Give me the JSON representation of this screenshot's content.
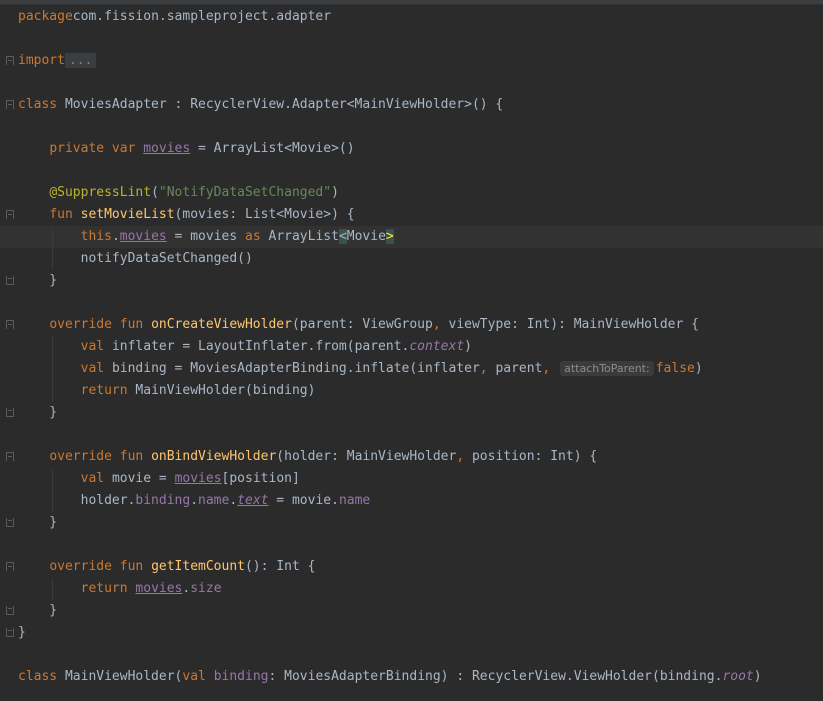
{
  "editor": {
    "lines": [
      {
        "parts": [
          [
            "kw",
            "package"
          ],
          [
            "",
            "com.fission.sampleproject.adapter"
          ]
        ]
      },
      {
        "parts": []
      },
      {
        "parts": [
          [
            "kw",
            "import"
          ],
          [
            "",
            ""
          ],
          [
            "fold-dots",
            "..."
          ]
        ]
      },
      {
        "parts": []
      },
      {
        "parts": [
          [
            "kw",
            "class"
          ],
          [
            "",
            " MoviesAdapter : RecyclerView.Adapter<MainViewHolder>() {"
          ]
        ]
      },
      {
        "parts": []
      },
      {
        "parts": [
          [
            "",
            "    "
          ],
          [
            "kw",
            "private var "
          ],
          [
            "prop ul",
            "movies"
          ],
          [
            "",
            " = ArrayList<Movie>()"
          ]
        ]
      },
      {
        "parts": []
      },
      {
        "parts": [
          [
            "",
            "    "
          ],
          [
            "ann",
            "@SuppressLint"
          ],
          [
            "",
            "("
          ],
          [
            "str",
            "\"NotifyDataSetChanged\""
          ],
          [
            "",
            ")"
          ]
        ]
      },
      {
        "parts": [
          [
            "",
            "    "
          ],
          [
            "kw",
            "fun "
          ],
          [
            "fn",
            "setMovieList"
          ],
          [
            "",
            "(movies: List<Movie>) {"
          ]
        ]
      },
      {
        "parts": [
          [
            "",
            "        "
          ],
          [
            "kw",
            "this"
          ],
          [
            "",
            "."
          ],
          [
            "prop ul",
            "movies"
          ],
          [
            "",
            " = movies "
          ],
          [
            "kw",
            "as"
          ],
          [
            "",
            " ArrayList"
          ],
          [
            "brace-match",
            "<"
          ],
          [
            "",
            "Movie"
          ],
          [
            "brace-match yel",
            ">"
          ]
        ]
      },
      {
        "parts": [
          [
            "",
            "        notifyDataSetChanged()"
          ]
        ]
      },
      {
        "parts": [
          [
            "",
            "    }"
          ]
        ]
      },
      {
        "parts": []
      },
      {
        "parts": [
          [
            "",
            "    "
          ],
          [
            "kw",
            "override fun "
          ],
          [
            "fn",
            "onCreateViewHolder"
          ],
          [
            "",
            "(parent: ViewGroup"
          ],
          [
            "kw",
            ", "
          ],
          [
            "",
            "viewType: Int): MainViewHolder {"
          ]
        ]
      },
      {
        "parts": [
          [
            "",
            "        "
          ],
          [
            "kw",
            "val "
          ],
          [
            "",
            "inflater = LayoutInflater.from(parent."
          ],
          [
            "prop it",
            "context"
          ],
          [
            "",
            ")"
          ]
        ]
      },
      {
        "parts": [
          [
            "",
            "        "
          ],
          [
            "kw",
            "val "
          ],
          [
            "",
            "binding = MoviesAdapterBinding.inflate(inflater"
          ],
          [
            "kw",
            ", "
          ],
          [
            "",
            "parent"
          ],
          [
            "kw",
            ", "
          ],
          [
            "hint",
            "attachToParent:"
          ],
          [
            "kw",
            "false"
          ],
          [
            "",
            ")"
          ]
        ]
      },
      {
        "parts": [
          [
            "",
            "        "
          ],
          [
            "kw",
            "return "
          ],
          [
            "",
            "MainViewHolder(binding)"
          ]
        ]
      },
      {
        "parts": [
          [
            "",
            "    }"
          ]
        ]
      },
      {
        "parts": []
      },
      {
        "parts": [
          [
            "",
            "    "
          ],
          [
            "kw",
            "override fun "
          ],
          [
            "fn",
            "onBindViewHolder"
          ],
          [
            "",
            "(holder: MainViewHolder"
          ],
          [
            "kw",
            ", "
          ],
          [
            "",
            "position: Int) {"
          ]
        ]
      },
      {
        "parts": [
          [
            "",
            "        "
          ],
          [
            "kw",
            "val "
          ],
          [
            "",
            "movie = "
          ],
          [
            "prop ul",
            "movies"
          ],
          [
            "",
            "[position]"
          ]
        ]
      },
      {
        "parts": [
          [
            "",
            "        holder."
          ],
          [
            "prop",
            "binding"
          ],
          [
            "",
            "."
          ],
          [
            "prop",
            "name"
          ],
          [
            "",
            "."
          ],
          [
            "prop it ul",
            "text"
          ],
          [
            "",
            " = movie."
          ],
          [
            "prop",
            "name"
          ]
        ]
      },
      {
        "parts": [
          [
            "",
            "    }"
          ]
        ]
      },
      {
        "parts": []
      },
      {
        "parts": [
          [
            "",
            "    "
          ],
          [
            "kw",
            "override fun "
          ],
          [
            "fn",
            "getItemCount"
          ],
          [
            "",
            "(): Int {"
          ]
        ]
      },
      {
        "parts": [
          [
            "",
            "        "
          ],
          [
            "kw",
            "return "
          ],
          [
            "prop ul",
            "movies"
          ],
          [
            "",
            "."
          ],
          [
            "prop",
            "size"
          ]
        ]
      },
      {
        "parts": [
          [
            "",
            "    }"
          ]
        ]
      },
      {
        "parts": [
          [
            "",
            "}"
          ]
        ]
      },
      {
        "parts": []
      },
      {
        "parts": [
          [
            "kw",
            "class"
          ],
          [
            "",
            " MainViewHolder("
          ],
          [
            "kw",
            "val "
          ],
          [
            "prop",
            "binding"
          ],
          [
            "",
            ": MoviesAdapterBinding) : RecyclerView.ViewHolder(binding."
          ],
          [
            "prop it",
            "root"
          ],
          [
            "",
            ")"
          ]
        ]
      }
    ]
  }
}
